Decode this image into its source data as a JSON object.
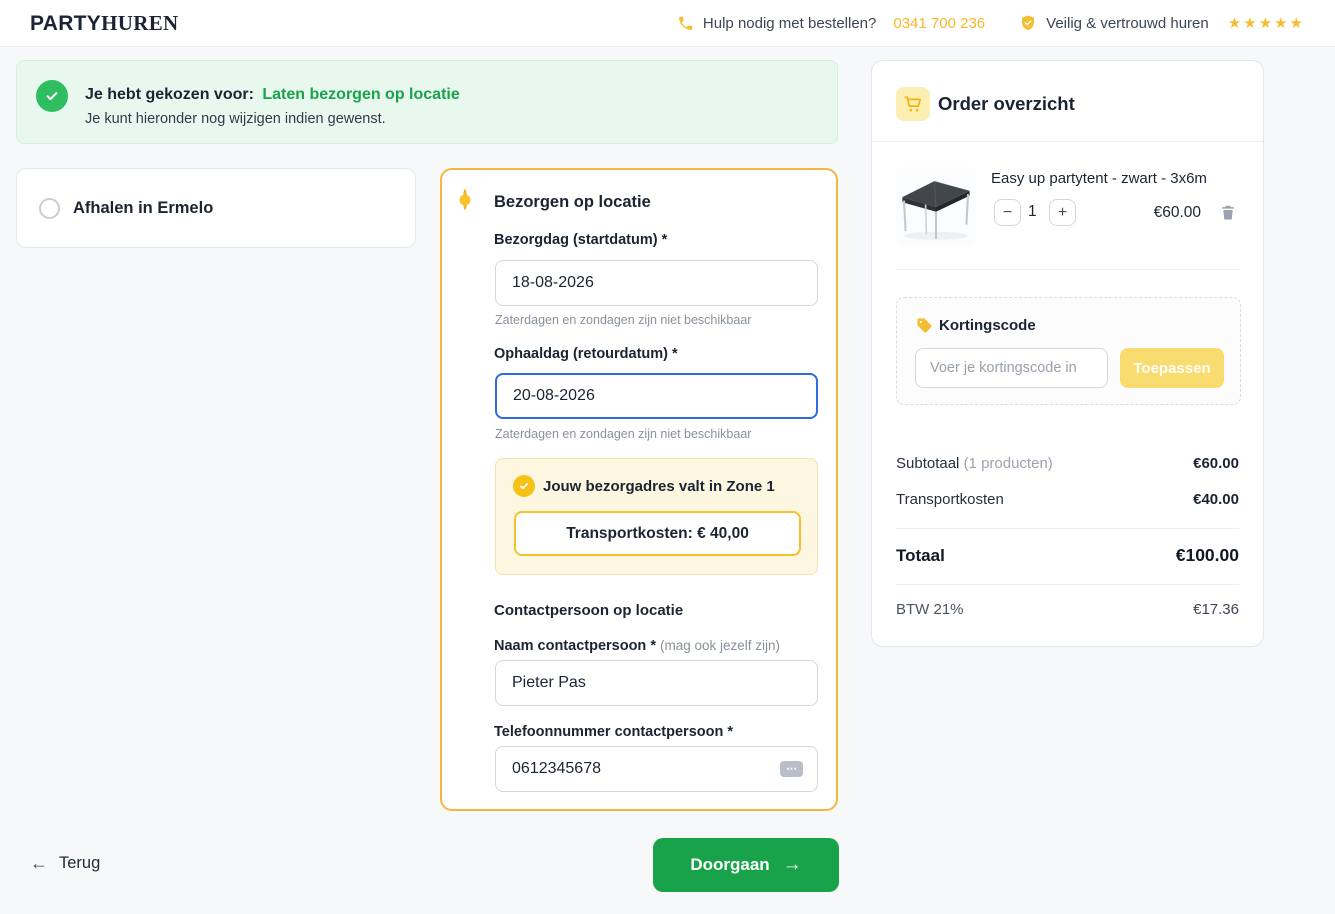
{
  "header": {
    "logo_part1": "PARTY",
    "logo_part2": "HUREN",
    "help_text": "Hulp nodig met bestellen?",
    "phone_number": "0341 700 236",
    "trust_text": "Veilig & vertrouwd huren"
  },
  "banner": {
    "title_prefix": "Je hebt gekozen voor:",
    "title_choice": "Laten bezorgen op locatie",
    "subtitle": "Je kunt hieronder nog wijzigen indien gewenst."
  },
  "pickup_option": {
    "label": "Afhalen in Ermelo"
  },
  "delivery_form": {
    "title": "Bezorgen op locatie",
    "delivery_date_label": "Bezorgdag (startdatum) *",
    "delivery_date_value": "18-08-2026",
    "delivery_date_helper": "Zaterdagen en zondagen zijn niet beschikbaar",
    "return_date_label": "Ophaaldag (retourdatum) *",
    "return_date_value": "20-08-2026",
    "return_date_helper": "Zaterdagen en zondagen zijn niet beschikbaar",
    "zone_message": "Jouw bezorgadres valt in Zone 1",
    "zone_transport_cost": "Transportkosten: € 40,00",
    "contact_heading": "Contactpersoon op locatie",
    "contact_name_label": "Naam contactpersoon *",
    "contact_name_hint": "(mag ook jezelf zijn)",
    "contact_name_value": "Pieter Pas",
    "contact_phone_label": "Telefoonnummer contactpersoon *",
    "contact_phone_value": "0612345678"
  },
  "order": {
    "title": "Order overzicht",
    "item": {
      "name": "Easy up partytent - zwart - 3x6m",
      "quantity": "1",
      "price": "€60.00"
    },
    "discount": {
      "title": "Kortingscode",
      "placeholder": "Voer je kortingscode in",
      "apply_label": "Toepassen"
    },
    "totals": {
      "subtotal_label": "Subtotaal",
      "subtotal_count": "(1 producten)",
      "subtotal_value": "€60.00",
      "transport_label": "Transportkosten",
      "transport_value": "€40.00",
      "total_label": "Totaal",
      "total_value": "€100.00",
      "vat_label": "BTW 21%",
      "vat_value": "€17.36"
    }
  },
  "footer": {
    "back_label": "Terug",
    "continue_label": "Doorgaan"
  },
  "icons": {
    "star": "★",
    "minus": "−",
    "plus": "+",
    "arrow_left": "←",
    "arrow_right": "→",
    "autofill_dots": "⋯"
  },
  "colors": {
    "accent_yellow": "#F5BE32",
    "green_primary": "#18A34B",
    "success_green": "#2EBE5F",
    "focus_blue": "#2F6AE0"
  }
}
